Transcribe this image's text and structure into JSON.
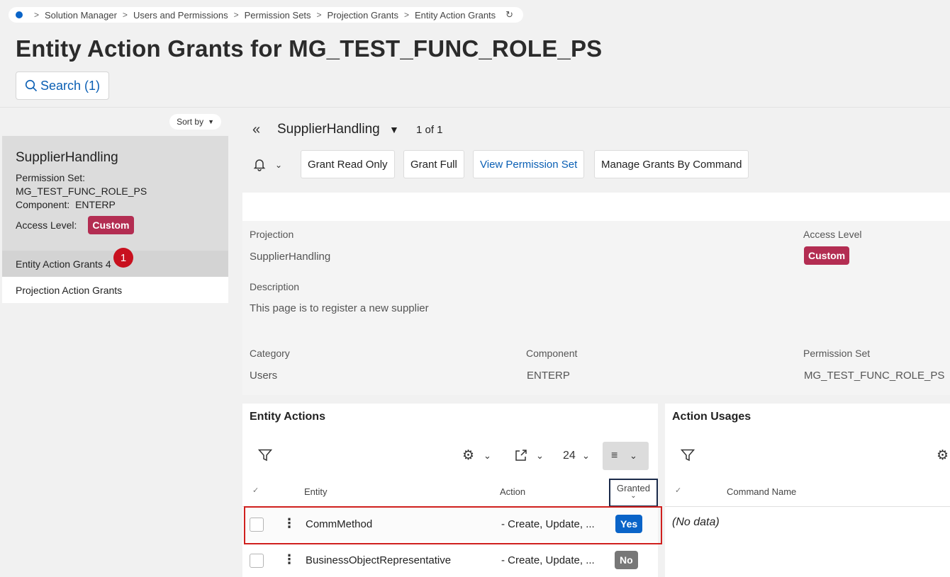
{
  "breadcrumb": {
    "items": [
      "Solution Manager",
      "Users and Permissions",
      "Permission Sets",
      "Projection Grants",
      "Entity Action Grants"
    ]
  },
  "page": {
    "title": "Entity Action Grants for MG_TEST_FUNC_ROLE_PS",
    "search_label": "Search (1)"
  },
  "left": {
    "sort_label": "Sort by",
    "record": {
      "title": "SupplierHandling",
      "permission_set_label": "Permission Set:",
      "permission_set_value": "MG_TEST_FUNC_ROLE_PS",
      "component_label": "Component:",
      "component_value": "ENTERP",
      "access_label": "Access Level:",
      "access_value": "Custom"
    },
    "nav": [
      {
        "label": "Entity Action Grants 4",
        "badge": "1"
      },
      {
        "label": "Projection Action Grants"
      }
    ]
  },
  "header": {
    "record_title": "SupplierHandling",
    "count": "1 of 1"
  },
  "toolbar": {
    "grant_read_only": "Grant Read Only",
    "grant_full": "Grant Full",
    "view_permission_set": "View Permission Set",
    "manage_grants": "Manage Grants By Command"
  },
  "details": {
    "projection_label": "Projection",
    "projection_value": "SupplierHandling",
    "access_level_label": "Access Level",
    "access_level_value": "Custom",
    "description_label": "Description",
    "description_value": "This page is to register a new supplier",
    "category_label": "Category",
    "category_value": "Users",
    "component_label": "Component",
    "component_value": "ENTERP",
    "permission_set_label": "Permission Set",
    "permission_set_value": "MG_TEST_FUNC_ROLE_PS"
  },
  "entity_actions": {
    "title": "Entity Actions",
    "page_size": "24",
    "columns": {
      "entity": "Entity",
      "action": "Action",
      "granted": "Granted"
    },
    "rows": [
      {
        "entity": "CommMethod",
        "action": "- Create, Update, ...",
        "granted": "Yes"
      },
      {
        "entity": "BusinessObjectRepresentative",
        "action": "- Create, Update, ...",
        "granted": "No"
      }
    ]
  },
  "action_usages": {
    "title": "Action Usages",
    "columns": {
      "command_name": "Command Name"
    },
    "empty": "(No data)"
  },
  "colors": {
    "accent": "#0a64c8",
    "custom_badge": "#b32d52",
    "no_badge": "#777777",
    "highlight": "#d0201e"
  }
}
